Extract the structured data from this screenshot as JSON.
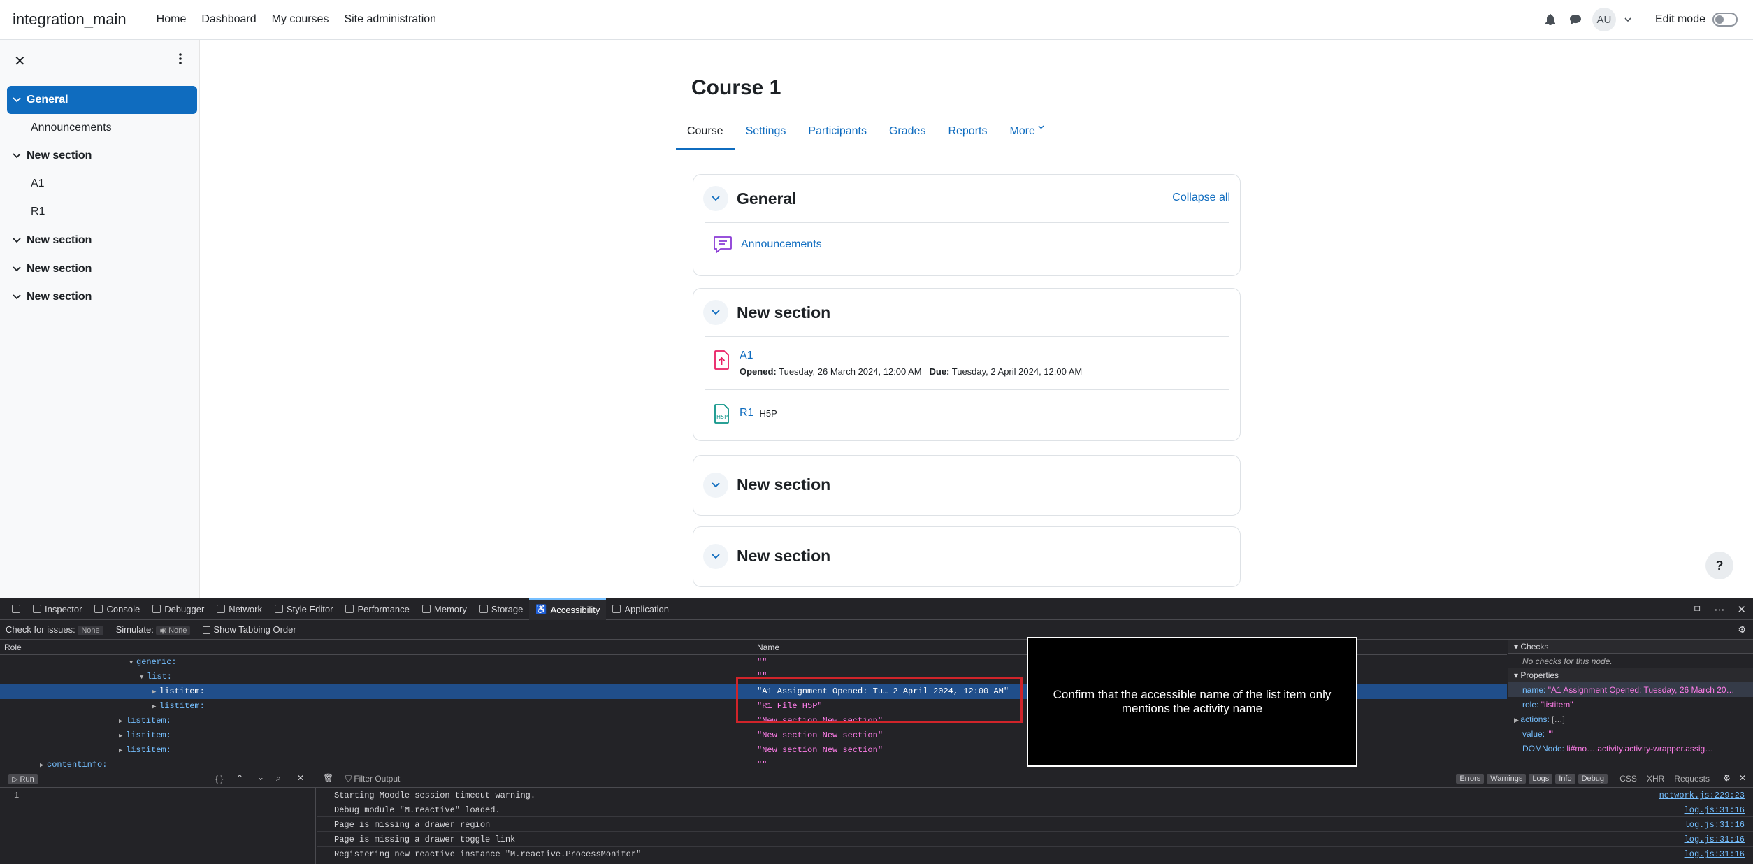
{
  "navbar": {
    "brand": "integration_main",
    "links": [
      "Home",
      "Dashboard",
      "My courses",
      "Site administration"
    ],
    "avatar_initials": "AU",
    "edit_mode_label": "Edit mode"
  },
  "drawer": {
    "items": [
      {
        "label": "General",
        "type": "section",
        "active": true
      },
      {
        "label": "Announcements",
        "type": "activity"
      },
      {
        "label": "New section",
        "type": "section"
      },
      {
        "label": "A1",
        "type": "activity"
      },
      {
        "label": "R1",
        "type": "activity"
      },
      {
        "label": "New section",
        "type": "section"
      },
      {
        "label": "New section",
        "type": "section"
      },
      {
        "label": "New section",
        "type": "section"
      }
    ]
  },
  "course": {
    "title": "Course 1",
    "tabs": [
      "Course",
      "Settings",
      "Participants",
      "Grades",
      "Reports",
      "More"
    ],
    "collapse_all": "Collapse all",
    "sections": [
      {
        "title": "General",
        "activities": [
          {
            "name": "Announcements"
          }
        ]
      },
      {
        "title": "New section",
        "activities": [
          {
            "name": "A1",
            "opened_label": "Opened:",
            "opened": "Tuesday, 26 March 2024, 12:00 AM",
            "due_label": "Due:",
            "due": "Tuesday, 2 April 2024, 12:00 AM"
          },
          {
            "name": "R1",
            "suffix": "H5P"
          }
        ]
      },
      {
        "title": "New section"
      },
      {
        "title": "New section"
      }
    ],
    "help": "?"
  },
  "devtools": {
    "tabs": [
      "Inspector",
      "Console",
      "Debugger",
      "Network",
      "Style Editor",
      "Performance",
      "Memory",
      "Storage",
      "Accessibility",
      "Application"
    ],
    "active_tab": "Accessibility",
    "toolbar": {
      "check_label": "Check for issues:",
      "check_value": "None",
      "simulate_label": "Simulate:",
      "simulate_value": "None",
      "tabbing_label": "Show Tabbing Order"
    },
    "columns": {
      "role": "Role",
      "name": "Name"
    },
    "tree": [
      {
        "role": "generic:",
        "name": "\"\""
      },
      {
        "role": "list:",
        "name": "\"\""
      },
      {
        "role": "listitem:",
        "name": "\"A1 Assignment Opened: Tu… 2 April 2024, 12:00 AM\"",
        "selected": true
      },
      {
        "role": "listitem:",
        "name": "\"R1 File H5P\""
      },
      {
        "role": "listitem:",
        "name": "\"New section New section\""
      },
      {
        "role": "listitem:",
        "name": "\"New section New section\""
      },
      {
        "role": "listitem:",
        "name": "\"New section New section\""
      },
      {
        "role": "contentinfo:",
        "name": "\"\""
      }
    ],
    "annotation": "Confirm that the accessible name of the list item only mentions the activity name",
    "side": {
      "checks_title": "Checks",
      "checks_empty": "No checks for this node.",
      "props_title": "Properties",
      "props": [
        {
          "k": "name:",
          "v": "\"A1 Assignment Opened: Tuesday, 26 March 20…"
        },
        {
          "k": "role:",
          "v": "\"listitem\""
        },
        {
          "k": "actions:",
          "v": "[…]"
        },
        {
          "k": "value:",
          "v": "\"\""
        },
        {
          "k": "DOMNode:",
          "v": "li#mo….activity.activity-wrapper.assig…"
        }
      ]
    },
    "console": {
      "run": "Run",
      "filter_placeholder": "Filter Output",
      "filters": [
        "Errors",
        "Warnings",
        "Logs",
        "Info",
        "Debug"
      ],
      "filters2": [
        "CSS",
        "XHR",
        "Requests"
      ],
      "line_no": "1",
      "logs": [
        {
          "msg": "Starting Moodle session timeout warning.",
          "src": "network.js:229:23"
        },
        {
          "msg": "Debug module \"M.reactive\" loaded.",
          "src": "log.js:31:16"
        },
        {
          "msg": "Page is missing a drawer region",
          "src": "log.js:31:16"
        },
        {
          "msg": "Page is missing a drawer toggle link",
          "src": "log.js:31:16"
        },
        {
          "msg": "Registering new reactive instance \"M.reactive.ProcessMonitor\"",
          "src": "log.js:31:16"
        }
      ]
    }
  }
}
